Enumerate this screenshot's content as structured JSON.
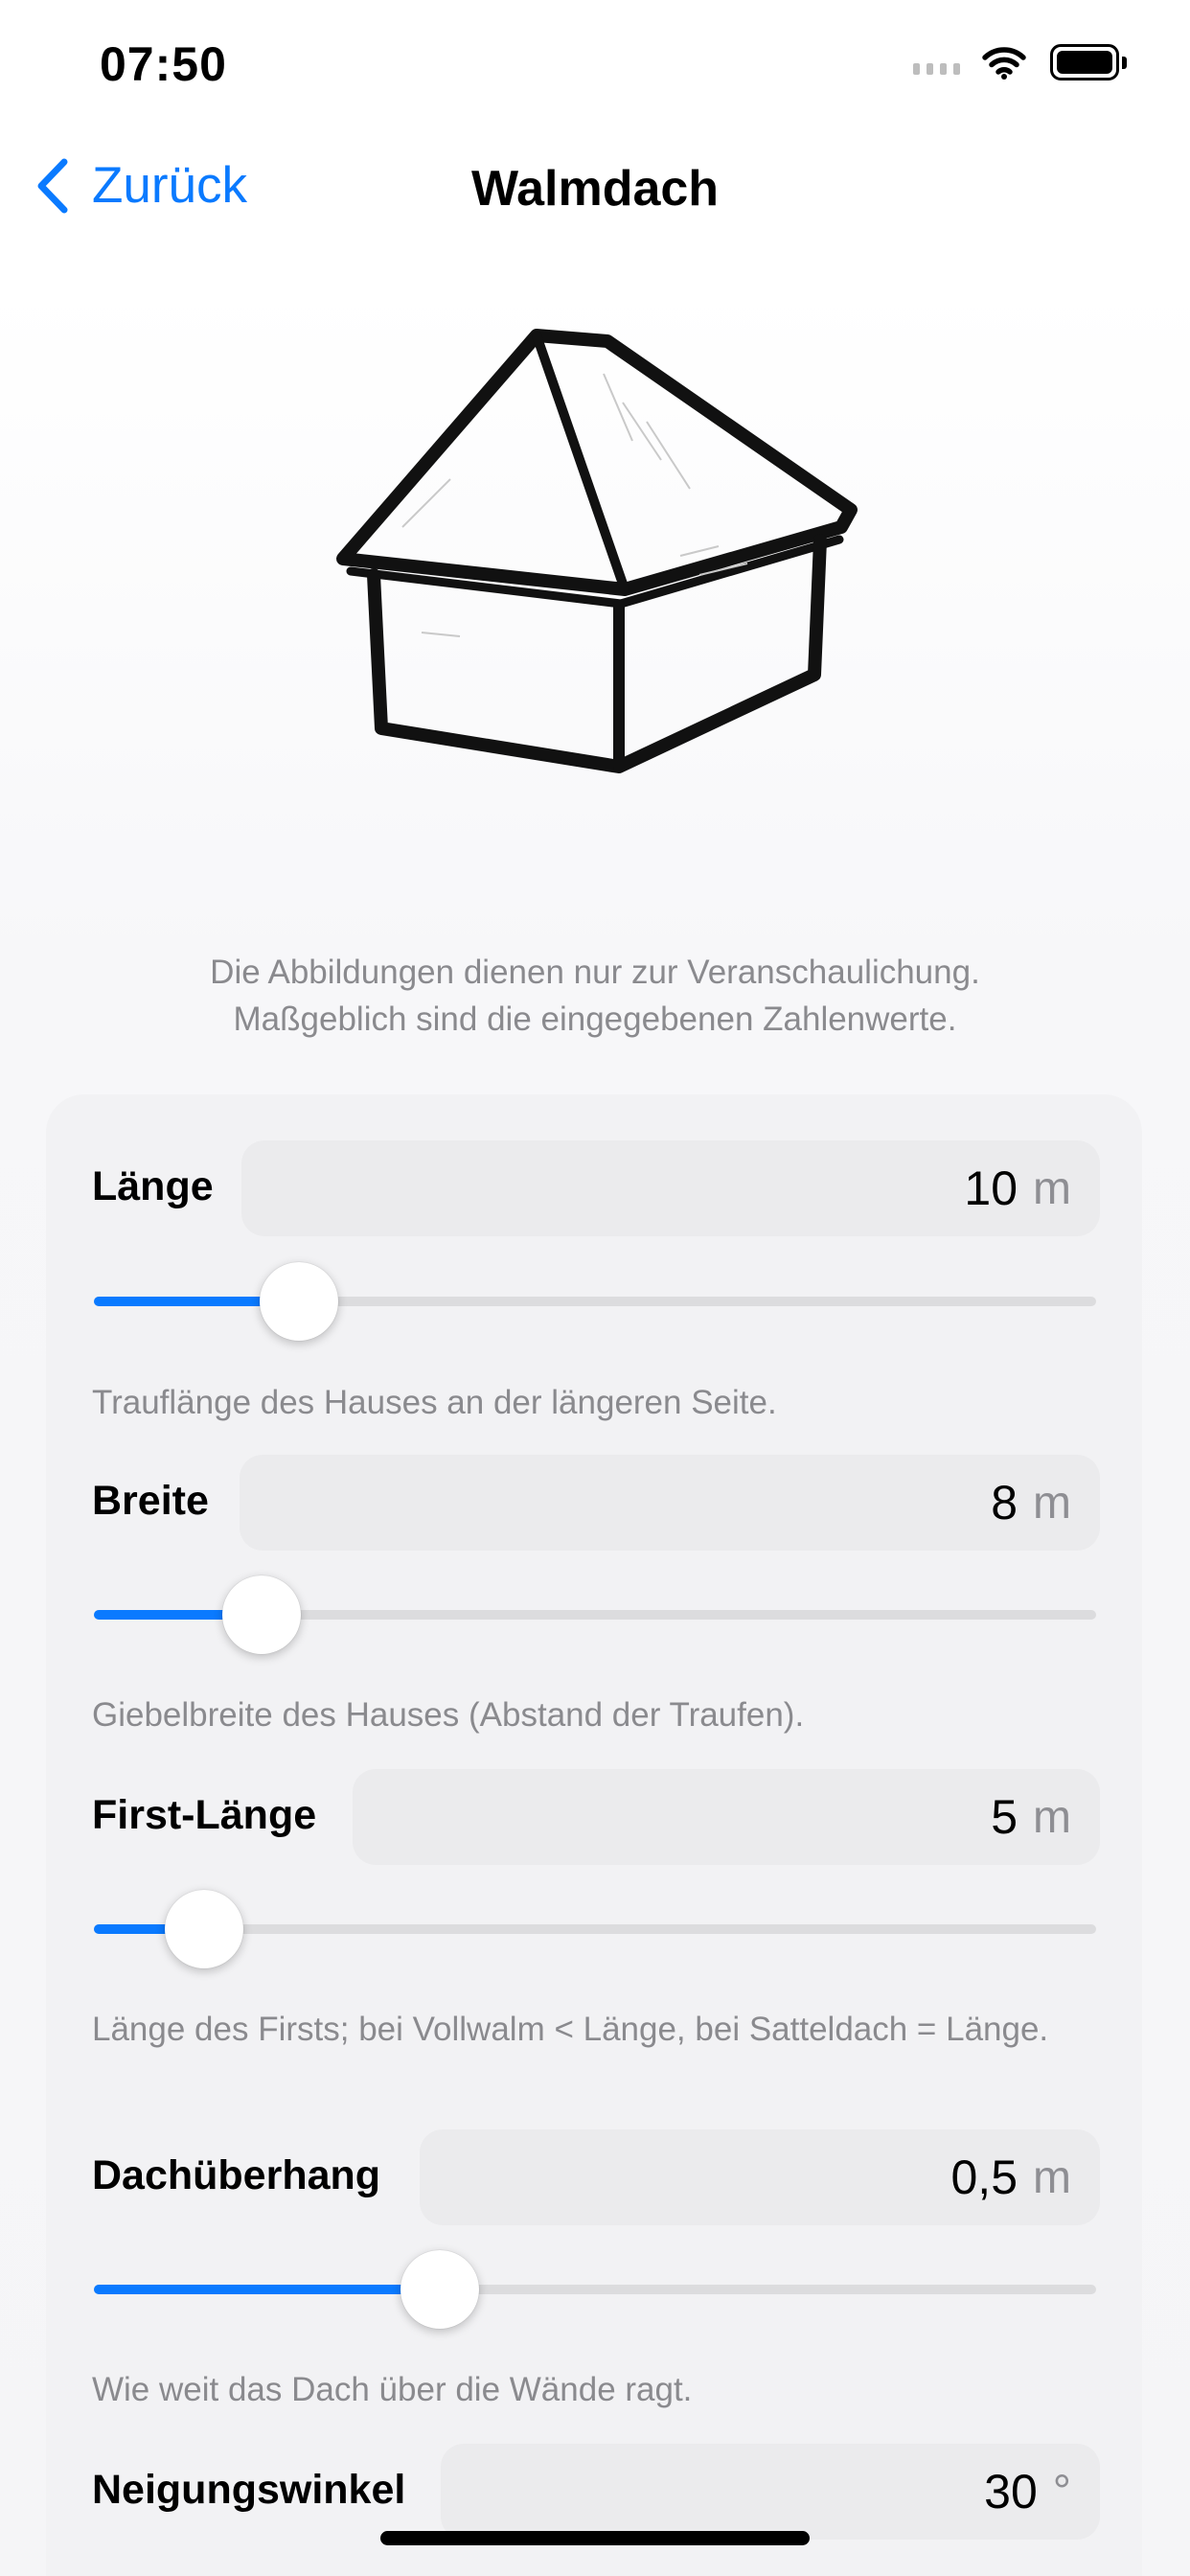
{
  "status_bar": {
    "time": "07:50"
  },
  "nav": {
    "back_label": "Zurück",
    "title": "Walmdach"
  },
  "caption": {
    "line1": "Die Abbildungen dienen nur zur Veranschaulichung.",
    "line2": "Maßgeblich sind die eingegebenen Zahlenwerte."
  },
  "fields": [
    {
      "label": "Länge",
      "value": "10",
      "unit": "m",
      "slider_fraction": 0.205,
      "help": "Trauflänge des Hauses an der längeren Seite."
    },
    {
      "label": "Breite",
      "value": "8",
      "unit": "m",
      "slider_fraction": 0.167,
      "help": "Giebelbreite des Hauses (Abstand der Traufen)."
    },
    {
      "label": "First-Länge",
      "value": "5",
      "unit": "m",
      "slider_fraction": 0.11,
      "help": "Länge des Firsts; bei Vollwalm < Länge, bei Satteldach = Länge."
    },
    {
      "label": "Dachüberhang",
      "value": "0,5",
      "unit": "m",
      "slider_fraction": 0.345,
      "help": "Wie weit das Dach über die Wände ragt."
    },
    {
      "label": "Neigungswinkel",
      "value": "30",
      "unit": "°"
    }
  ],
  "colors": {
    "accent": "#0a7aff",
    "card": "#f2f2f4",
    "input": "#ebebed",
    "secondary_text": "#8a8a8e"
  },
  "icons": {
    "back": "chevron-left-icon",
    "wifi": "wifi-icon",
    "battery": "battery-icon",
    "illustration": "hip-roof-house-sketch"
  }
}
